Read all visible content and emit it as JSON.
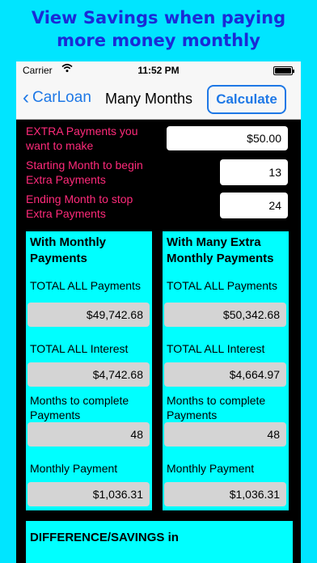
{
  "promo": {
    "line1": "View Savings when paying",
    "line2": "more money monthly"
  },
  "status": {
    "carrier": "Carrier",
    "time": "11:52 PM"
  },
  "nav": {
    "back_label": "CarLoan",
    "title": "Many Months",
    "calculate_label": "Calculate"
  },
  "form": {
    "extra_label_1": "EXTRA Payments you",
    "extra_label_2": "want to make",
    "extra_value": "$50.00",
    "start_label_1": "Starting Month to begin",
    "start_label_2": "Extra Payments",
    "start_value": "13",
    "end_label_1": "Ending Month to stop",
    "end_label_2": "Extra Payments",
    "end_value": "24"
  },
  "left_card": {
    "head_1": "With Monthly",
    "head_2": "Payments",
    "total_payments_label": "TOTAL ALL Payments",
    "total_payments": "$49,742.68",
    "total_interest_label": "TOTAL ALL Interest",
    "total_interest": "$4,742.68",
    "months_label_1": "Months to complete",
    "months_label_2": "Payments",
    "months": "48",
    "monthly_label": "Monthly Payment",
    "monthly": "$1,036.31"
  },
  "right_card": {
    "head_1": "With Many Extra",
    "head_2": "Monthly Payments",
    "total_payments_label": "TOTAL ALL Payments",
    "total_payments": "$50,342.68",
    "total_interest_label": "TOTAL ALL Interest",
    "total_interest": "$4,664.97",
    "months_label_1": "Months to complete",
    "months_label_2": "Payments",
    "months": "48",
    "monthly_label": "Monthly Payment",
    "monthly": "$1,036.31"
  },
  "difference": {
    "head": "DIFFERENCE/SAVINGS in"
  },
  "colors": {
    "background": "#00e5ff",
    "promo_text": "#1a2bd6",
    "ios_blue": "#1e78e6",
    "label_pink": "#ff2a7a",
    "card": "#00ffff"
  },
  "icons": {
    "wifi": "wifi-icon",
    "battery": "battery-icon",
    "back": "chevron-left-icon"
  }
}
